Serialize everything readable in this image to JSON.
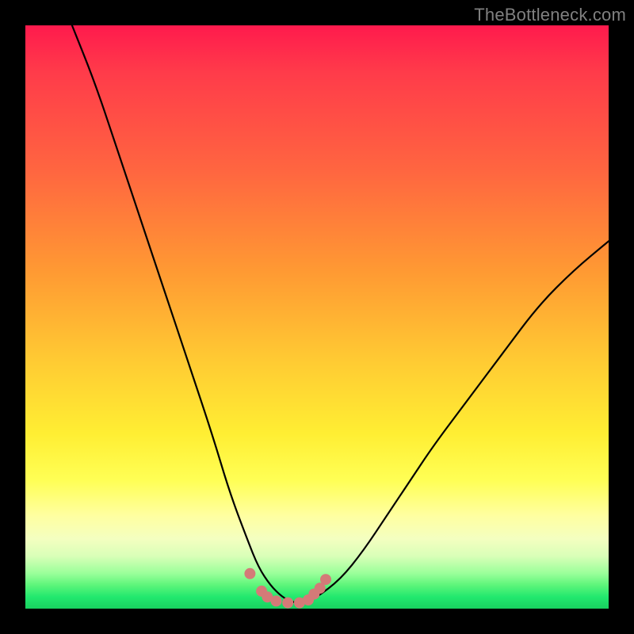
{
  "watermark": {
    "text": "TheBottleneck.com"
  },
  "colors": {
    "frame": "#000000",
    "gradient_top": "#ff1a4d",
    "gradient_mid": "#ffee33",
    "gradient_bottom": "#18d160",
    "curve_stroke": "#000000",
    "marker_fill": "#d47a78"
  },
  "chart_data": {
    "type": "line",
    "title": "",
    "xlabel": "",
    "ylabel": "",
    "xlim": [
      0,
      100
    ],
    "ylim": [
      0,
      100
    ],
    "note": "Axes are unlabeled; values are percent of plot area. y=0 at bottom, y=100 at top.",
    "series": [
      {
        "name": "bottleneck-curve",
        "x": [
          8,
          12,
          16,
          20,
          24,
          28,
          32,
          35,
          38,
          40,
          42,
          44,
          46,
          48,
          50,
          54,
          58,
          62,
          66,
          70,
          76,
          82,
          88,
          94,
          100
        ],
        "y": [
          100,
          90,
          78,
          66,
          54,
          42,
          30,
          20,
          12,
          7,
          4,
          2,
          1,
          1,
          2,
          5,
          10,
          16,
          22,
          28,
          36,
          44,
          52,
          58,
          63
        ]
      }
    ],
    "markers": {
      "name": "floor-dots",
      "x": [
        38.5,
        40.5,
        41.5,
        43,
        45,
        47,
        48.5,
        49.5,
        50.5,
        51.5
      ],
      "y": [
        6.0,
        3.0,
        2.0,
        1.3,
        1.0,
        1.0,
        1.5,
        2.5,
        3.5,
        5.0
      ],
      "r": 7
    }
  }
}
